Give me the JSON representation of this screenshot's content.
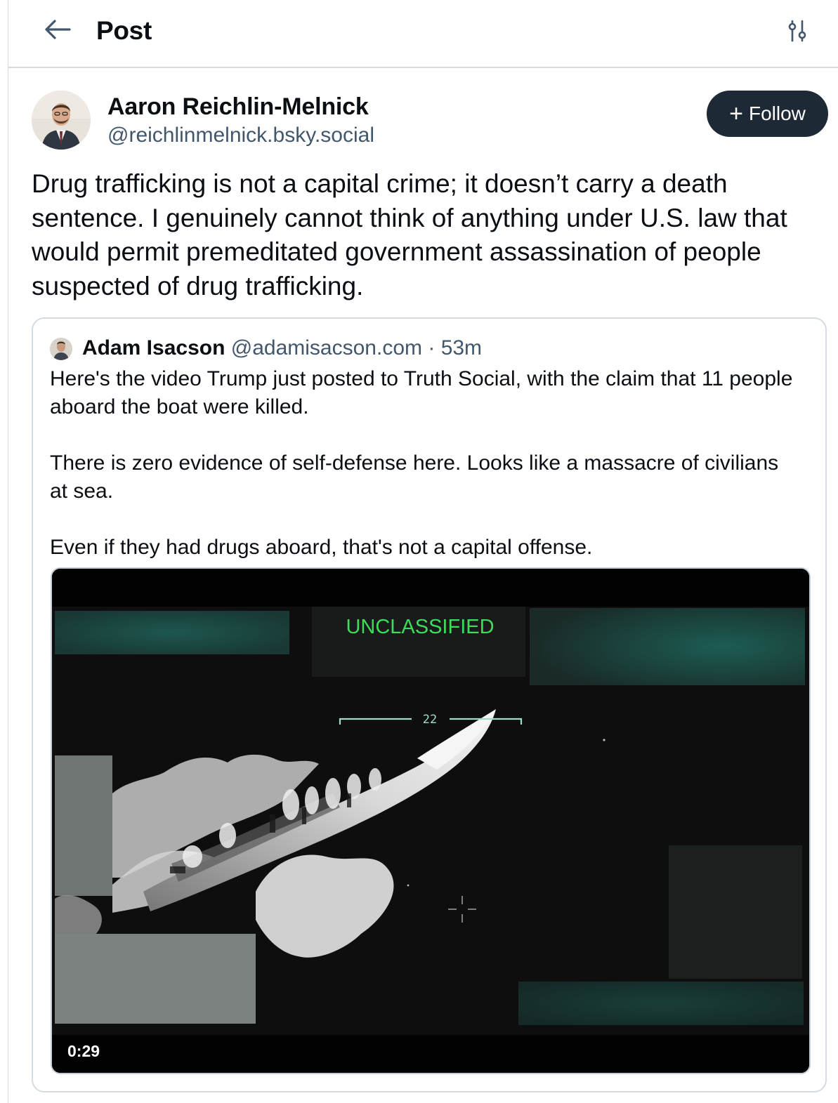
{
  "header": {
    "title": "Post",
    "back_icon": "arrow-left-icon",
    "filter_icon": "sliders-icon"
  },
  "post": {
    "author_name": "Aaron Reichlin-Melnick",
    "author_handle": "@reichlinmelnick.bsky.social",
    "follow_label": "Follow",
    "text": "Drug trafficking is not a capital crime; it doesn’t carry a death sentence. I genuinely cannot think of anything under U.S. law that would permit premeditated government assassination of people suspected of drug trafficking."
  },
  "quote": {
    "author_name": "Adam Isacson",
    "author_handle": "@adamisacson.com",
    "separator": "·",
    "time": "53m",
    "paragraphs": [
      "Here's the video Trump just posted to Truth Social, with the claim that 11 people aboard the boat were killed.",
      "There is zero evidence of self-defense here. Looks like a massacre of civilians at sea.",
      "Even if they had drugs aboard, that's not a capital offense."
    ],
    "video": {
      "overlay_label": "UNCLASSIFIED",
      "reticle_number": "22",
      "duration": "0:29"
    }
  },
  "colors": {
    "follow_bg": "#1e2936",
    "muted_text": "#42576c",
    "border": "#d4dbe2",
    "hud_green": "#3ddc5a"
  }
}
